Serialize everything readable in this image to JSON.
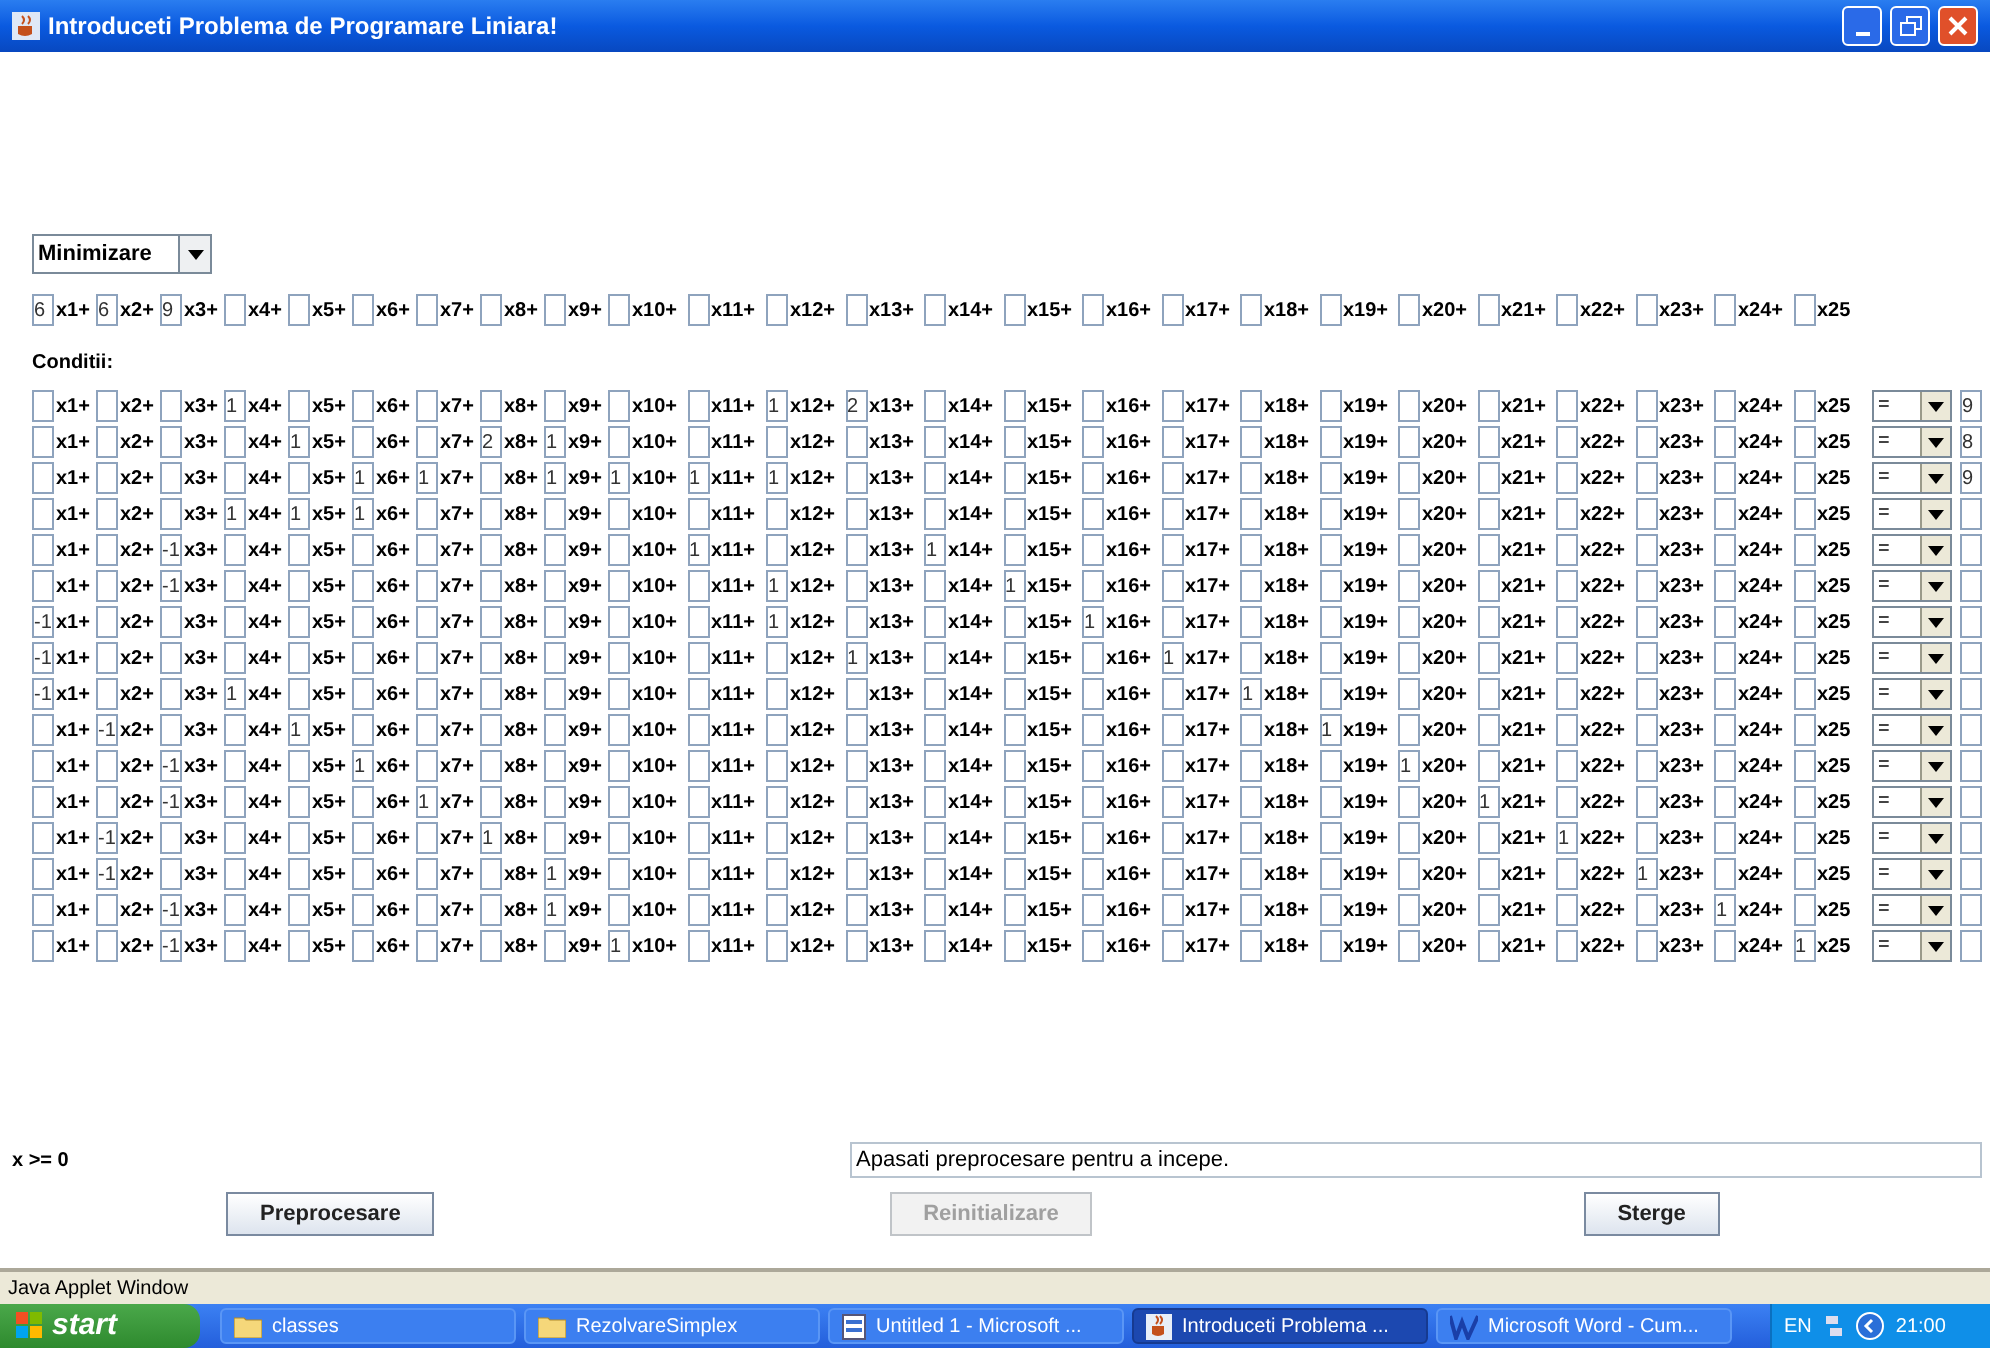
{
  "window": {
    "title": "Introduceti Problema de Programare Liniara!"
  },
  "objective": {
    "mode": "Minimizare",
    "terms": [
      {
        "coefficient": "6",
        "variable": "x1+"
      },
      {
        "coefficient": "6",
        "variable": "x2+"
      },
      {
        "coefficient": "9",
        "variable": "x3+"
      },
      {
        "variable": "x4+"
      },
      {
        "variable": "x5+"
      },
      {
        "variable": "x6+"
      },
      {
        "variable": "x7+"
      },
      {
        "variable": "x8+"
      },
      {
        "variable": "x9+"
      },
      {
        "variable": "x10+"
      },
      {
        "variable": "x11+"
      },
      {
        "variable": "x12+"
      },
      {
        "variable": "x13+"
      },
      {
        "variable": "x14+"
      },
      {
        "variable": "x15+"
      },
      {
        "variable": "x16+"
      },
      {
        "variable": "x17+"
      },
      {
        "variable": "x18+"
      },
      {
        "variable": "x19+"
      },
      {
        "variable": "x20+"
      },
      {
        "variable": "x21+"
      },
      {
        "variable": "x22+"
      },
      {
        "variable": "x23+"
      },
      {
        "variable": "x24+"
      },
      {
        "variable": "x25"
      }
    ]
  },
  "constraints_label": "Conditii:",
  "constraints": [
    {
      "relation": "=",
      "rhs": "9",
      "terms": [
        {
          "variable": "x1+"
        },
        {
          "variable": "x2+"
        },
        {
          "variable": "x3+"
        },
        {
          "coefficient": "1",
          "variable": "x4+"
        },
        {
          "variable": "x5+"
        },
        {
          "variable": "x6+"
        },
        {
          "variable": "x7+"
        },
        {
          "variable": "x8+"
        },
        {
          "variable": "x9+"
        },
        {
          "variable": "x10+"
        },
        {
          "variable": "x11+"
        },
        {
          "coefficient": "1",
          "variable": "x12+"
        },
        {
          "coefficient": "2",
          "variable": "x13+"
        },
        {
          "variable": "x14+"
        },
        {
          "variable": "x15+"
        },
        {
          "variable": "x16+"
        },
        {
          "variable": "x17+"
        },
        {
          "variable": "x18+"
        },
        {
          "variable": "x19+"
        },
        {
          "variable": "x20+"
        },
        {
          "variable": "x21+"
        },
        {
          "variable": "x22+"
        },
        {
          "variable": "x23+"
        },
        {
          "variable": "x24+"
        },
        {
          "variable": "x25"
        }
      ]
    },
    {
      "relation": "=",
      "rhs": "8",
      "terms": [
        {
          "variable": "x1+"
        },
        {
          "variable": "x2+"
        },
        {
          "variable": "x3+"
        },
        {
          "variable": "x4+"
        },
        {
          "coefficient": "1",
          "variable": "x5+"
        },
        {
          "variable": "x6+"
        },
        {
          "variable": "x7+"
        },
        {
          "coefficient": "2",
          "variable": "x8+"
        },
        {
          "coefficient": "1",
          "variable": "x9+"
        },
        {
          "variable": "x10+"
        },
        {
          "variable": "x11+"
        },
        {
          "variable": "x12+"
        },
        {
          "variable": "x13+"
        },
        {
          "variable": "x14+"
        },
        {
          "variable": "x15+"
        },
        {
          "variable": "x16+"
        },
        {
          "variable": "x17+"
        },
        {
          "variable": "x18+"
        },
        {
          "variable": "x19+"
        },
        {
          "variable": "x20+"
        },
        {
          "variable": "x21+"
        },
        {
          "variable": "x22+"
        },
        {
          "variable": "x23+"
        },
        {
          "variable": "x24+"
        },
        {
          "variable": "x25"
        }
      ]
    },
    {
      "relation": "=",
      "rhs": "9",
      "terms": [
        {
          "variable": "x1+"
        },
        {
          "variable": "x2+"
        },
        {
          "variable": "x3+"
        },
        {
          "variable": "x4+"
        },
        {
          "variable": "x5+"
        },
        {
          "coefficient": "1",
          "variable": "x6+"
        },
        {
          "coefficient": "1",
          "variable": "x7+"
        },
        {
          "variable": "x8+"
        },
        {
          "coefficient": "1",
          "variable": "x9+"
        },
        {
          "coefficient": "1",
          "variable": "x10+"
        },
        {
          "coefficient": "1",
          "variable": "x11+"
        },
        {
          "coefficient": "1",
          "variable": "x12+"
        },
        {
          "variable": "x13+"
        },
        {
          "variable": "x14+"
        },
        {
          "variable": "x15+"
        },
        {
          "variable": "x16+"
        },
        {
          "variable": "x17+"
        },
        {
          "variable": "x18+"
        },
        {
          "variable": "x19+"
        },
        {
          "variable": "x20+"
        },
        {
          "variable": "x21+"
        },
        {
          "variable": "x22+"
        },
        {
          "variable": "x23+"
        },
        {
          "variable": "x24+"
        },
        {
          "variable": "x25"
        }
      ]
    },
    {
      "relation": "=",
      "terms": [
        {
          "variable": "x1+"
        },
        {
          "variable": "x2+"
        },
        {
          "variable": "x3+"
        },
        {
          "coefficient": "1",
          "variable": "x4+"
        },
        {
          "coefficient": "1",
          "variable": "x5+"
        },
        {
          "coefficient": "1",
          "variable": "x6+"
        },
        {
          "variable": "x7+"
        },
        {
          "variable": "x8+"
        },
        {
          "variable": "x9+"
        },
        {
          "variable": "x10+"
        },
        {
          "variable": "x11+"
        },
        {
          "variable": "x12+"
        },
        {
          "variable": "x13+"
        },
        {
          "variable": "x14+"
        },
        {
          "variable": "x15+"
        },
        {
          "variable": "x16+"
        },
        {
          "variable": "x17+"
        },
        {
          "variable": "x18+"
        },
        {
          "variable": "x19+"
        },
        {
          "variable": "x20+"
        },
        {
          "variable": "x21+"
        },
        {
          "variable": "x22+"
        },
        {
          "variable": "x23+"
        },
        {
          "variable": "x24+"
        },
        {
          "variable": "x25"
        }
      ]
    },
    {
      "relation": "=",
      "terms": [
        {
          "variable": "x1+"
        },
        {
          "variable": "x2+"
        },
        {
          "coefficient": "-1",
          "variable": "x3+"
        },
        {
          "variable": "x4+"
        },
        {
          "variable": "x5+"
        },
        {
          "variable": "x6+"
        },
        {
          "variable": "x7+"
        },
        {
          "variable": "x8+"
        },
        {
          "variable": "x9+"
        },
        {
          "variable": "x10+"
        },
        {
          "coefficient": "1",
          "variable": "x11+"
        },
        {
          "variable": "x12+"
        },
        {
          "variable": "x13+"
        },
        {
          "coefficient": "1",
          "variable": "x14+"
        },
        {
          "variable": "x15+"
        },
        {
          "variable": "x16+"
        },
        {
          "variable": "x17+"
        },
        {
          "variable": "x18+"
        },
        {
          "variable": "x19+"
        },
        {
          "variable": "x20+"
        },
        {
          "variable": "x21+"
        },
        {
          "variable": "x22+"
        },
        {
          "variable": "x23+"
        },
        {
          "variable": "x24+"
        },
        {
          "variable": "x25"
        }
      ]
    },
    {
      "relation": "=",
      "terms": [
        {
          "variable": "x1+"
        },
        {
          "variable": "x2+"
        },
        {
          "coefficient": "-1",
          "variable": "x3+"
        },
        {
          "variable": "x4+"
        },
        {
          "variable": "x5+"
        },
        {
          "variable": "x6+"
        },
        {
          "variable": "x7+"
        },
        {
          "variable": "x8+"
        },
        {
          "variable": "x9+"
        },
        {
          "variable": "x10+"
        },
        {
          "variable": "x11+"
        },
        {
          "coefficient": "1",
          "variable": "x12+"
        },
        {
          "variable": "x13+"
        },
        {
          "variable": "x14+"
        },
        {
          "coefficient": "1",
          "variable": "x15+"
        },
        {
          "variable": "x16+"
        },
        {
          "variable": "x17+"
        },
        {
          "variable": "x18+"
        },
        {
          "variable": "x19+"
        },
        {
          "variable": "x20+"
        },
        {
          "variable": "x21+"
        },
        {
          "variable": "x22+"
        },
        {
          "variable": "x23+"
        },
        {
          "variable": "x24+"
        },
        {
          "variable": "x25"
        }
      ]
    },
    {
      "relation": "=",
      "terms": [
        {
          "coefficient": "-1",
          "variable": "x1+"
        },
        {
          "variable": "x2+"
        },
        {
          "variable": "x3+"
        },
        {
          "variable": "x4+"
        },
        {
          "variable": "x5+"
        },
        {
          "variable": "x6+"
        },
        {
          "variable": "x7+"
        },
        {
          "variable": "x8+"
        },
        {
          "variable": "x9+"
        },
        {
          "variable": "x10+"
        },
        {
          "variable": "x11+"
        },
        {
          "coefficient": "1",
          "variable": "x12+"
        },
        {
          "variable": "x13+"
        },
        {
          "variable": "x14+"
        },
        {
          "variable": "x15+"
        },
        {
          "coefficient": "1",
          "variable": "x16+"
        },
        {
          "variable": "x17+"
        },
        {
          "variable": "x18+"
        },
        {
          "variable": "x19+"
        },
        {
          "variable": "x20+"
        },
        {
          "variable": "x21+"
        },
        {
          "variable": "x22+"
        },
        {
          "variable": "x23+"
        },
        {
          "variable": "x24+"
        },
        {
          "variable": "x25"
        }
      ]
    },
    {
      "relation": "=",
      "terms": [
        {
          "coefficient": "-1",
          "variable": "x1+"
        },
        {
          "variable": "x2+"
        },
        {
          "variable": "x3+"
        },
        {
          "variable": "x4+"
        },
        {
          "variable": "x5+"
        },
        {
          "variable": "x6+"
        },
        {
          "variable": "x7+"
        },
        {
          "variable": "x8+"
        },
        {
          "variable": "x9+"
        },
        {
          "variable": "x10+"
        },
        {
          "variable": "x11+"
        },
        {
          "variable": "x12+"
        },
        {
          "coefficient": "1",
          "variable": "x13+"
        },
        {
          "variable": "x14+"
        },
        {
          "variable": "x15+"
        },
        {
          "variable": "x16+"
        },
        {
          "coefficient": "1",
          "variable": "x17+"
        },
        {
          "variable": "x18+"
        },
        {
          "variable": "x19+"
        },
        {
          "variable": "x20+"
        },
        {
          "variable": "x21+"
        },
        {
          "variable": "x22+"
        },
        {
          "variable": "x23+"
        },
        {
          "variable": "x24+"
        },
        {
          "variable": "x25"
        }
      ]
    },
    {
      "relation": "=",
      "terms": [
        {
          "coefficient": "-1",
          "variable": "x1+"
        },
        {
          "variable": "x2+"
        },
        {
          "variable": "x3+"
        },
        {
          "coefficient": "1",
          "variable": "x4+"
        },
        {
          "variable": "x5+"
        },
        {
          "variable": "x6+"
        },
        {
          "variable": "x7+"
        },
        {
          "variable": "x8+"
        },
        {
          "variable": "x9+"
        },
        {
          "variable": "x10+"
        },
        {
          "variable": "x11+"
        },
        {
          "variable": "x12+"
        },
        {
          "variable": "x13+"
        },
        {
          "variable": "x14+"
        },
        {
          "variable": "x15+"
        },
        {
          "variable": "x16+"
        },
        {
          "variable": "x17+"
        },
        {
          "coefficient": "1",
          "variable": "x18+"
        },
        {
          "variable": "x19+"
        },
        {
          "variable": "x20+"
        },
        {
          "variable": "x21+"
        },
        {
          "variable": "x22+"
        },
        {
          "variable": "x23+"
        },
        {
          "variable": "x24+"
        },
        {
          "variable": "x25"
        }
      ]
    },
    {
      "relation": "=",
      "terms": [
        {
          "variable": "x1+"
        },
        {
          "coefficient": "-1",
          "variable": "x2+"
        },
        {
          "variable": "x3+"
        },
        {
          "variable": "x4+"
        },
        {
          "coefficient": "1",
          "variable": "x5+"
        },
        {
          "variable": "x6+"
        },
        {
          "variable": "x7+"
        },
        {
          "variable": "x8+"
        },
        {
          "variable": "x9+"
        },
        {
          "variable": "x10+"
        },
        {
          "variable": "x11+"
        },
        {
          "variable": "x12+"
        },
        {
          "variable": "x13+"
        },
        {
          "variable": "x14+"
        },
        {
          "variable": "x15+"
        },
        {
          "variable": "x16+"
        },
        {
          "variable": "x17+"
        },
        {
          "variable": "x18+"
        },
        {
          "coefficient": "1",
          "variable": "x19+"
        },
        {
          "variable": "x20+"
        },
        {
          "variable": "x21+"
        },
        {
          "variable": "x22+"
        },
        {
          "variable": "x23+"
        },
        {
          "variable": "x24+"
        },
        {
          "variable": "x25"
        }
      ]
    },
    {
      "relation": "=",
      "terms": [
        {
          "variable": "x1+"
        },
        {
          "variable": "x2+"
        },
        {
          "coefficient": "-1",
          "variable": "x3+"
        },
        {
          "variable": "x4+"
        },
        {
          "variable": "x5+"
        },
        {
          "coefficient": "1",
          "variable": "x6+"
        },
        {
          "variable": "x7+"
        },
        {
          "variable": "x8+"
        },
        {
          "variable": "x9+"
        },
        {
          "variable": "x10+"
        },
        {
          "variable": "x11+"
        },
        {
          "variable": "x12+"
        },
        {
          "variable": "x13+"
        },
        {
          "variable": "x14+"
        },
        {
          "variable": "x15+"
        },
        {
          "variable": "x16+"
        },
        {
          "variable": "x17+"
        },
        {
          "variable": "x18+"
        },
        {
          "variable": "x19+"
        },
        {
          "coefficient": "1",
          "variable": "x20+"
        },
        {
          "variable": "x21+"
        },
        {
          "variable": "x22+"
        },
        {
          "variable": "x23+"
        },
        {
          "variable": "x24+"
        },
        {
          "variable": "x25"
        }
      ]
    },
    {
      "relation": "=",
      "terms": [
        {
          "variable": "x1+"
        },
        {
          "variable": "x2+"
        },
        {
          "coefficient": "-1",
          "variable": "x3+"
        },
        {
          "variable": "x4+"
        },
        {
          "variable": "x5+"
        },
        {
          "variable": "x6+"
        },
        {
          "coefficient": "1",
          "variable": "x7+"
        },
        {
          "variable": "x8+"
        },
        {
          "variable": "x9+"
        },
        {
          "variable": "x10+"
        },
        {
          "variable": "x11+"
        },
        {
          "variable": "x12+"
        },
        {
          "variable": "x13+"
        },
        {
          "variable": "x14+"
        },
        {
          "variable": "x15+"
        },
        {
          "variable": "x16+"
        },
        {
          "variable": "x17+"
        },
        {
          "variable": "x18+"
        },
        {
          "variable": "x19+"
        },
        {
          "variable": "x20+"
        },
        {
          "coefficient": "1",
          "variable": "x21+"
        },
        {
          "variable": "x22+"
        },
        {
          "variable": "x23+"
        },
        {
          "variable": "x24+"
        },
        {
          "variable": "x25"
        }
      ]
    },
    {
      "relation": "=",
      "terms": [
        {
          "variable": "x1+"
        },
        {
          "coefficient": "-1",
          "variable": "x2+"
        },
        {
          "variable": "x3+"
        },
        {
          "variable": "x4+"
        },
        {
          "variable": "x5+"
        },
        {
          "variable": "x6+"
        },
        {
          "variable": "x7+"
        },
        {
          "coefficient": "1",
          "variable": "x8+"
        },
        {
          "variable": "x9+"
        },
        {
          "variable": "x10+"
        },
        {
          "variable": "x11+"
        },
        {
          "variable": "x12+"
        },
        {
          "variable": "x13+"
        },
        {
          "variable": "x14+"
        },
        {
          "variable": "x15+"
        },
        {
          "variable": "x16+"
        },
        {
          "variable": "x17+"
        },
        {
          "variable": "x18+"
        },
        {
          "variable": "x19+"
        },
        {
          "variable": "x20+"
        },
        {
          "variable": "x21+"
        },
        {
          "coefficient": "1",
          "variable": "x22+"
        },
        {
          "variable": "x23+"
        },
        {
          "variable": "x24+"
        },
        {
          "variable": "x25"
        }
      ]
    },
    {
      "relation": "=",
      "terms": [
        {
          "variable": "x1+"
        },
        {
          "coefficient": "-1",
          "variable": "x2+"
        },
        {
          "variable": "x3+"
        },
        {
          "variable": "x4+"
        },
        {
          "variable": "x5+"
        },
        {
          "variable": "x6+"
        },
        {
          "variable": "x7+"
        },
        {
          "variable": "x8+"
        },
        {
          "coefficient": "1",
          "variable": "x9+"
        },
        {
          "variable": "x10+"
        },
        {
          "variable": "x11+"
        },
        {
          "variable": "x12+"
        },
        {
          "variable": "x13+"
        },
        {
          "variable": "x14+"
        },
        {
          "variable": "x15+"
        },
        {
          "variable": "x16+"
        },
        {
          "variable": "x17+"
        },
        {
          "variable": "x18+"
        },
        {
          "variable": "x19+"
        },
        {
          "variable": "x20+"
        },
        {
          "variable": "x21+"
        },
        {
          "variable": "x22+"
        },
        {
          "coefficient": "1",
          "variable": "x23+"
        },
        {
          "variable": "x24+"
        },
        {
          "variable": "x25"
        }
      ]
    },
    {
      "relation": "=",
      "terms": [
        {
          "variable": "x1+"
        },
        {
          "variable": "x2+"
        },
        {
          "coefficient": "-1",
          "variable": "x3+"
        },
        {
          "variable": "x4+"
        },
        {
          "variable": "x5+"
        },
        {
          "variable": "x6+"
        },
        {
          "variable": "x7+"
        },
        {
          "variable": "x8+"
        },
        {
          "coefficient": "1",
          "variable": "x9+"
        },
        {
          "variable": "x10+"
        },
        {
          "variable": "x11+"
        },
        {
          "variable": "x12+"
        },
        {
          "variable": "x13+"
        },
        {
          "variable": "x14+"
        },
        {
          "variable": "x15+"
        },
        {
          "variable": "x16+"
        },
        {
          "variable": "x17+"
        },
        {
          "variable": "x18+"
        },
        {
          "variable": "x19+"
        },
        {
          "variable": "x20+"
        },
        {
          "variable": "x21+"
        },
        {
          "variable": "x22+"
        },
        {
          "variable": "x23+"
        },
        {
          "coefficient": "1",
          "variable": "x24+"
        },
        {
          "variable": "x25"
        }
      ]
    },
    {
      "relation": "=",
      "terms": [
        {
          "variable": "x1+"
        },
        {
          "variable": "x2+"
        },
        {
          "coefficient": "-1",
          "variable": "x3+"
        },
        {
          "variable": "x4+"
        },
        {
          "variable": "x5+"
        },
        {
          "variable": "x6+"
        },
        {
          "variable": "x7+"
        },
        {
          "variable": "x8+"
        },
        {
          "variable": "x9+"
        },
        {
          "coefficient": "1",
          "variable": "x10+"
        },
        {
          "variable": "x11+"
        },
        {
          "variable": "x12+"
        },
        {
          "variable": "x13+"
        },
        {
          "variable": "x14+"
        },
        {
          "variable": "x15+"
        },
        {
          "variable": "x16+"
        },
        {
          "variable": "x17+"
        },
        {
          "variable": "x18+"
        },
        {
          "variable": "x19+"
        },
        {
          "variable": "x20+"
        },
        {
          "variable": "x21+"
        },
        {
          "variable": "x22+"
        },
        {
          "variable": "x23+"
        },
        {
          "variable": "x24+"
        },
        {
          "coefficient": "1",
          "variable": "x25"
        }
      ]
    }
  ],
  "nonnegativity": "x >= 0",
  "status": "Apasati preprocesare pentru a incepe.",
  "buttons": [
    {
      "label": "Preprocesare",
      "disabled": false
    },
    {
      "label": "Reinitializare",
      "disabled": true
    },
    {
      "label": "Sterge",
      "disabled": false
    }
  ],
  "applet_bar": "Java Applet Window",
  "taskbar": {
    "start": "start",
    "items": [
      {
        "label": "classes",
        "kind": "folder",
        "selected": false
      },
      {
        "label": "RezolvareSimplex",
        "kind": "folder",
        "selected": false
      },
      {
        "label": "Untitled 1 - Microsoft ...",
        "kind": "browser",
        "selected": false
      },
      {
        "label": "Introduceti Problema ...",
        "kind": "java",
        "selected": true
      },
      {
        "label": "Microsoft Word - Cum...",
        "kind": "word",
        "selected": false
      }
    ],
    "language": "EN",
    "clock": "21:00"
  }
}
